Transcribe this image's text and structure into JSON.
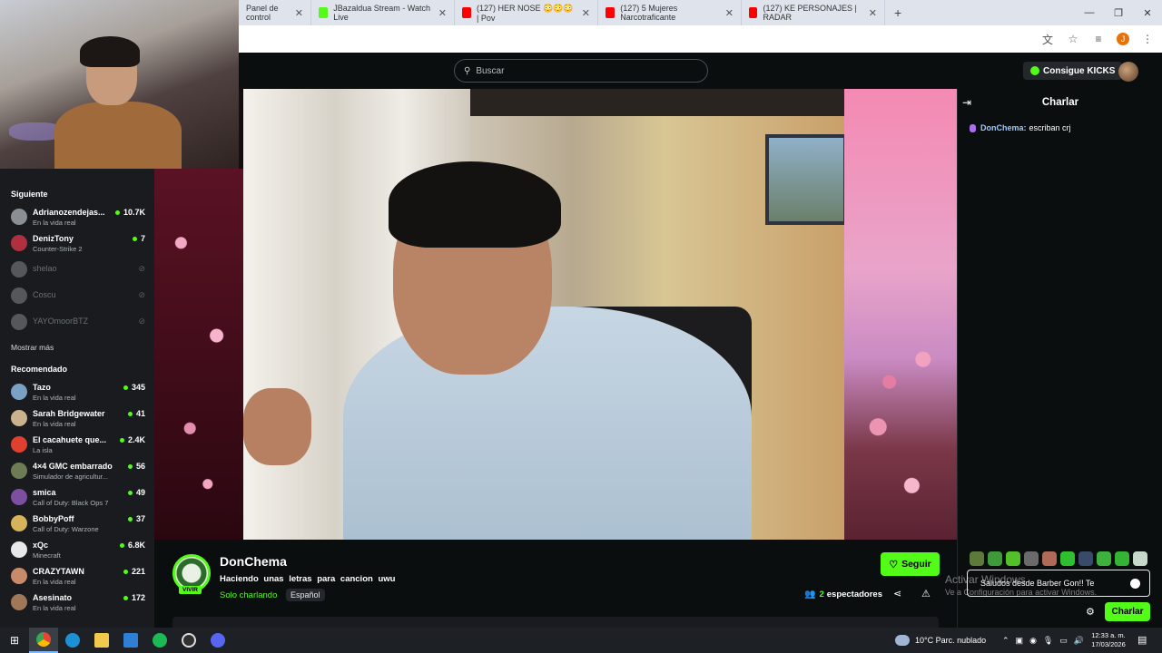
{
  "browser": {
    "tabs": [
      {
        "label": "Panel de control",
        "color": "#ff0000"
      },
      {
        "label": "JBazaldua Stream - Watch Live",
        "color": "#53fc18"
      },
      {
        "label": "(127) HER NOSE 😳😳😳 | Pov",
        "color": "#ff0000"
      },
      {
        "label": "(127) 5 Mujeres Narcotraficante",
        "color": "#ff0000"
      },
      {
        "label": "(127) KE PERSONAJES | RADAR",
        "color": "#ff0000"
      }
    ],
    "new_tab": "+",
    "profile_initial": "J"
  },
  "header": {
    "search_placeholder": "Buscar",
    "kicks_label": "Consigue KICKS"
  },
  "sidebar": {
    "following_title": "Siguiente",
    "following": [
      {
        "name": "Adrianozendejas...",
        "category": "En la vida real",
        "viewers": "10.7K",
        "avatar": "#8a8f94"
      },
      {
        "name": "DenizTony",
        "category": "Counter-Strike 2",
        "viewers": "7",
        "avatar": "#b03040"
      },
      {
        "name": "shelao",
        "category": "",
        "viewers": "",
        "avatar": "#777"
      },
      {
        "name": "Coscu",
        "category": "",
        "viewers": "",
        "avatar": "#777"
      },
      {
        "name": "YAYOmoorBTZ",
        "category": "",
        "viewers": "",
        "avatar": "#777"
      }
    ],
    "show_more": "Mostrar más",
    "recommended_title": "Recomendado",
    "recommended": [
      {
        "name": "Tazo",
        "category": "En la vida real",
        "viewers": "345",
        "avatar": "#7aa0c4"
      },
      {
        "name": "Sarah Bridgewater",
        "category": "En la vida real",
        "viewers": "41",
        "avatar": "#c9b28c"
      },
      {
        "name": "El cacahuete que...",
        "category": "La isla",
        "viewers": "2.4K",
        "avatar": "#e04030"
      },
      {
        "name": "4×4 GMC embarrado",
        "category": "Simulador de agricultur...",
        "viewers": "56",
        "avatar": "#6e7c55"
      },
      {
        "name": "smica",
        "category": "Call of Duty: Black Ops 7",
        "viewers": "49",
        "avatar": "#7c4fa0"
      },
      {
        "name": "BobbyPoff",
        "category": "Call of Duty: Warzone",
        "viewers": "37",
        "avatar": "#d6b35a"
      },
      {
        "name": "xQc",
        "category": "Minecraft",
        "viewers": "6.8K",
        "avatar": "#e8e8e8"
      },
      {
        "name": "CRAZYTAWN",
        "category": "En la vida real",
        "viewers": "221",
        "avatar": "#c98a6a"
      },
      {
        "name": "Asesinato",
        "category": "En la vida real",
        "viewers": "172",
        "avatar": "#a07858"
      }
    ]
  },
  "stream": {
    "channel": "DonChema",
    "live_badge": "VIVIR",
    "title": "Haciendo unas letras para cancion uwu",
    "category": "Solo charlando",
    "language": "Español",
    "viewers": "2",
    "viewers_label": "espectadores",
    "follow_label": "Seguir"
  },
  "chat": {
    "title": "Charlar",
    "messages": [
      {
        "user": "DonChema:",
        "text": "escriban crj"
      }
    ],
    "input_value": "Saludos desde Barber Gon!! Te",
    "send_label": "Charlar",
    "watermark_line1": "Activar Windows",
    "watermark_line2": "Ve a Configuración para activar Windows."
  },
  "taskbar": {
    "weather": "10°C  Parc. nublado",
    "time": "12:33 a. m.",
    "date": "17/03/2026"
  }
}
